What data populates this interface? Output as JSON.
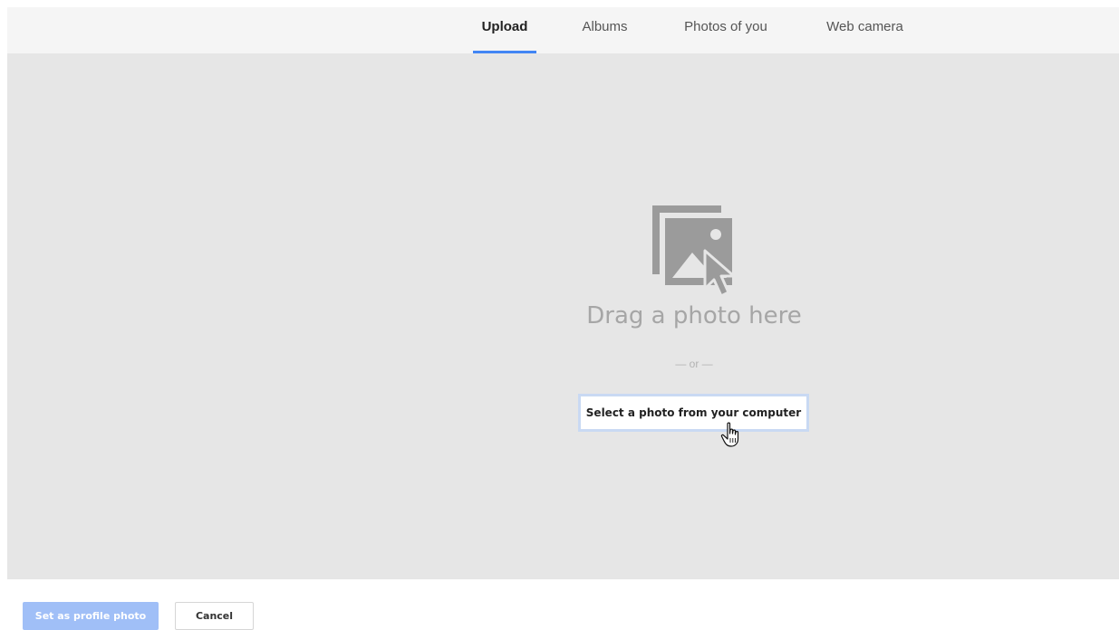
{
  "tabs": [
    {
      "label": "Upload",
      "active": true
    },
    {
      "label": "Albums",
      "active": false
    },
    {
      "label": "Photos of you",
      "active": false
    },
    {
      "label": "Web camera",
      "active": false
    }
  ],
  "dropzone": {
    "icon": "photo-upload-icon",
    "drag_text": "Drag a photo here",
    "or_text": "— or —",
    "select_button_label": "Select a photo from your computer",
    "cursor_icon": "hand-pointer-icon"
  },
  "footer": {
    "primary_label": "Set as profile photo",
    "primary_enabled": false,
    "cancel_label": "Cancel"
  },
  "colors": {
    "accent": "#4285f4",
    "primary_disabled": "#a0bff7",
    "dropzone_bg": "#e6e6e6",
    "tabbar_bg": "#f5f5f5",
    "icon_gray": "#9b9b9b"
  }
}
